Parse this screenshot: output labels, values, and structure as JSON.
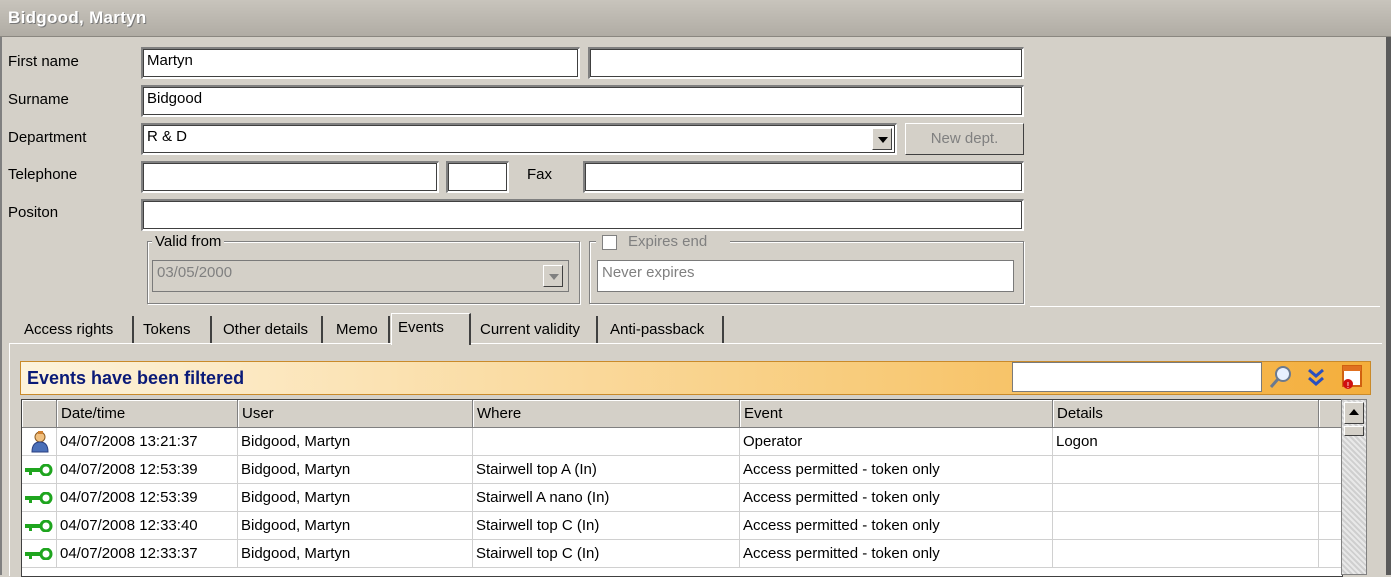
{
  "window": {
    "title": "Bidgood, Martyn"
  },
  "form": {
    "first_name_label": "First name",
    "first_name_value": "Martyn",
    "first_name_extra_value": "",
    "surname_label": "Surname",
    "surname_value": "Bidgood",
    "department_label": "Department",
    "department_value": "R & D",
    "new_dept_label": "New dept.",
    "telephone_label": "Telephone",
    "telephone_value": "",
    "telephone_ext_value": "",
    "fax_label": "Fax",
    "fax_value": "",
    "position_label": "Positon",
    "position_value": "",
    "valid_from_label": "Valid from",
    "valid_from_value": "03/05/2000",
    "expires_end_label": "Expires end",
    "expires_end_checked": false,
    "expires_value": "Never expires"
  },
  "tabs": [
    {
      "label": "Access rights"
    },
    {
      "label": "Tokens"
    },
    {
      "label": "Other details"
    },
    {
      "label": "Memo"
    },
    {
      "label": "Events",
      "active": true
    },
    {
      "label": "Current validity"
    },
    {
      "label": "Anti-passback"
    }
  ],
  "events": {
    "banner": "Events have been filtered",
    "filter_value": "",
    "columns": [
      "Date/time",
      "User",
      "Where",
      "Event",
      "Details"
    ],
    "rows": [
      {
        "icon": "operator-icon",
        "datetime": "04/07/2008  13:21:37",
        "user": "Bidgood, Martyn",
        "where": "",
        "event": "Operator",
        "details": "Logon"
      },
      {
        "icon": "key-icon",
        "datetime": "04/07/2008  12:53:39",
        "user": "Bidgood, Martyn",
        "where": "Stairwell top A (In)",
        "event": "Access permitted - token only",
        "details": ""
      },
      {
        "icon": "key-icon",
        "datetime": "04/07/2008  12:53:39",
        "user": "Bidgood, Martyn",
        "where": "Stairwell A nano (In)",
        "event": "Access permitted - token only",
        "details": ""
      },
      {
        "icon": "key-icon",
        "datetime": "04/07/2008  12:33:40",
        "user": "Bidgood, Martyn",
        "where": "Stairwell top C (In)",
        "event": "Access permitted - token only",
        "details": ""
      },
      {
        "icon": "key-icon",
        "datetime": "04/07/2008  12:33:37",
        "user": "Bidgood, Martyn",
        "where": "Stairwell top C (In)",
        "event": "Access permitted - token only",
        "details": ""
      }
    ]
  },
  "colors": {
    "banner_text": "#0a1a78",
    "key_icon": "#1fa51f",
    "banner_gradient_end": "#f4ae3b"
  }
}
